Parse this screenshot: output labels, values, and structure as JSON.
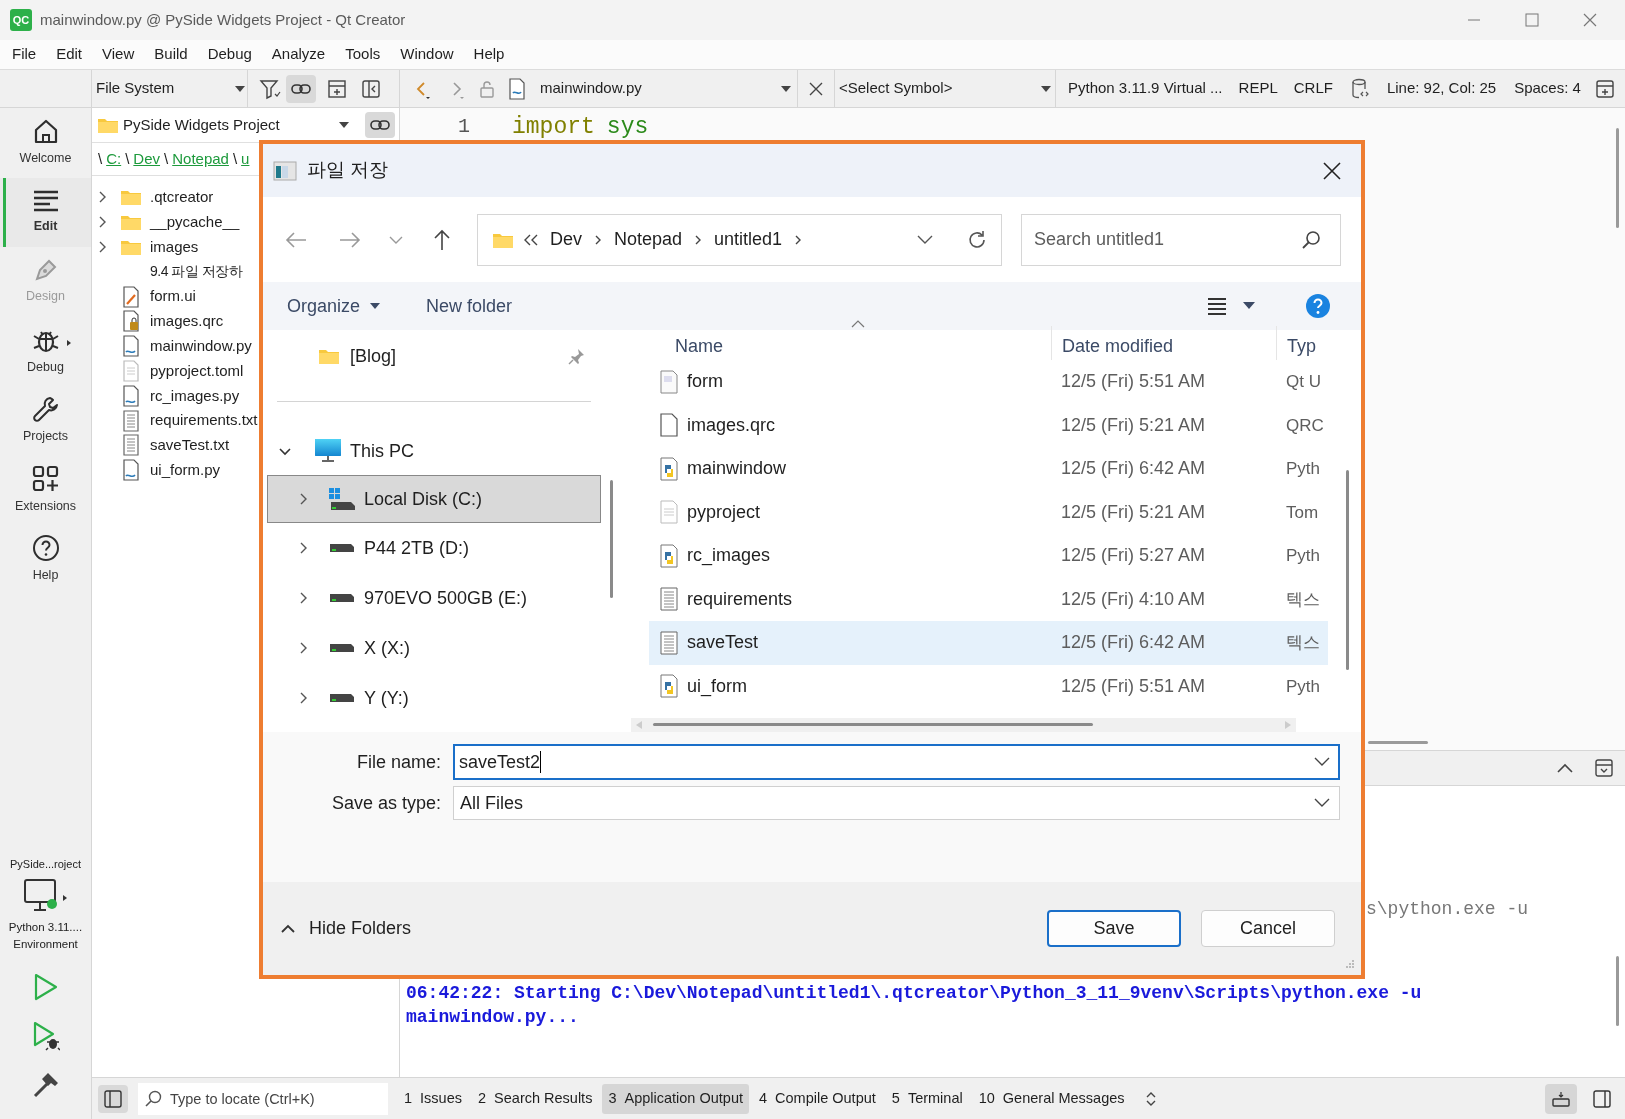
{
  "window": {
    "app_icon": "QC",
    "title": "mainwindow.py @ PySide Widgets Project - Qt Creator"
  },
  "menu": [
    "File",
    "Edit",
    "View",
    "Build",
    "Debug",
    "Analyze",
    "Tools",
    "Window",
    "Help"
  ],
  "toolbar": {
    "view_selector": "File System",
    "file_selector": "mainwindow.py",
    "symbol_selector": "<Select Symbol>",
    "interpreter": "Python 3.11.9 Virtual ...",
    "repl": "REPL",
    "line_endings": "CRLF",
    "position": "Line: 92, Col: 25",
    "indent": "Spaces: 4"
  },
  "modes": [
    {
      "label": "Welcome",
      "kind": "welcome",
      "selected": false,
      "disabled": false
    },
    {
      "label": "Edit",
      "kind": "edit",
      "selected": true,
      "disabled": false
    },
    {
      "label": "Design",
      "kind": "design",
      "selected": false,
      "disabled": true
    },
    {
      "label": "Debug",
      "kind": "debug",
      "selected": false,
      "disabled": false
    },
    {
      "label": "Projects",
      "kind": "projects",
      "selected": false,
      "disabled": false
    },
    {
      "label": "Extensions",
      "kind": "extensions",
      "selected": false,
      "disabled": false
    },
    {
      "label": "Help",
      "kind": "help",
      "selected": false,
      "disabled": false
    }
  ],
  "target": {
    "project": "PySide...roject",
    "kit": [
      "Python 3.11....",
      "Environment"
    ]
  },
  "project_tree": {
    "project": "PySide Widgets Project",
    "breadcrumb_separator": "\\",
    "breadcrumb": [
      "C:",
      "Dev",
      "Notepad",
      "u"
    ],
    "items": [
      {
        "name": ".qtcreator",
        "kind": "folder",
        "expanded": false
      },
      {
        "name": "__pycache__",
        "kind": "folder",
        "expanded": false
      },
      {
        "name": "images",
        "kind": "folder",
        "expanded": false
      },
      {
        "name": "9.4 파일 저장하",
        "kind": "plain"
      },
      {
        "name": "form.ui",
        "kind": "ui"
      },
      {
        "name": "images.qrc",
        "kind": "qrc"
      },
      {
        "name": "mainwindow.py",
        "kind": "py"
      },
      {
        "name": "pyproject.toml",
        "kind": "toml"
      },
      {
        "name": "rc_images.py",
        "kind": "py"
      },
      {
        "name": "requirements.txt",
        "kind": "txt"
      },
      {
        "name": "saveTest.txt",
        "kind": "txt"
      },
      {
        "name": "ui_form.py",
        "kind": "py"
      }
    ]
  },
  "editor": {
    "lines": [
      {
        "number": "1",
        "tokens": [
          {
            "text": "import",
            "kind": "keyword"
          },
          {
            "text": "sys",
            "kind": "module"
          }
        ]
      }
    ]
  },
  "output": [
    {
      "text": "s\\python.exe -u",
      "kind": "fragment"
    },
    {
      "text": "06:42:22: Starting C:\\Dev\\Notepad\\untitled1\\.qtcreator\\Python_3_11_9venv\\Scripts\\python.exe -u",
      "kind": "start"
    },
    {
      "text": "mainwindow.py...",
      "kind": "start"
    }
  ],
  "status_bar": {
    "locator_placeholder": "Type to locate (Ctrl+K)",
    "tabs": [
      {
        "number": "1",
        "label": "Issues",
        "selected": false
      },
      {
        "number": "2",
        "label": "Search Results",
        "selected": false
      },
      {
        "number": "3",
        "label": "Application Output",
        "selected": true
      },
      {
        "number": "4",
        "label": "Compile Output",
        "selected": false
      },
      {
        "number": "5",
        "label": "Terminal",
        "selected": false
      },
      {
        "number": "10",
        "label": "General Messages",
        "selected": false
      }
    ]
  },
  "dialog": {
    "title": "파일 저장",
    "address": [
      "Dev",
      "Notepad",
      "untitled1"
    ],
    "search_placeholder": "Search untitled1",
    "organize": "Organize",
    "new_folder": "New folder",
    "nav": [
      {
        "label": "[Blog]",
        "kind": "pinned",
        "selected": false
      },
      {
        "label": "This PC",
        "kind": "pc",
        "expanded": true,
        "selected": false
      },
      {
        "label": "Local Disk (C:)",
        "kind": "system_drive",
        "expanded": false,
        "selected": true
      },
      {
        "label": "P44 2TB (D:)",
        "kind": "drive",
        "expanded": false,
        "selected": false
      },
      {
        "label": "970EVO 500GB (E:)",
        "kind": "drive",
        "expanded": false,
        "selected": false
      },
      {
        "label": "X (X:)",
        "kind": "drive",
        "expanded": false,
        "selected": false
      },
      {
        "label": "Y (Y:)",
        "kind": "drive",
        "expanded": false,
        "selected": false
      }
    ],
    "columns": [
      "Name",
      "Date modified",
      "Typ"
    ],
    "files": [
      {
        "name": "form",
        "date": "12/5 (Fri) 5:51 AM",
        "type": "Qt U",
        "kind": "ui",
        "selected": false
      },
      {
        "name": "images.qrc",
        "date": "12/5 (Fri) 5:21 AM",
        "type": "QRC",
        "kind": "blank",
        "selected": false
      },
      {
        "name": "mainwindow",
        "date": "12/5 (Fri) 6:42 AM",
        "type": "Pyth",
        "kind": "python",
        "selected": false
      },
      {
        "name": "pyproject",
        "date": "12/5 (Fri) 5:21 AM",
        "type": "Tom",
        "kind": "config",
        "selected": false
      },
      {
        "name": "rc_images",
        "date": "12/5 (Fri) 5:27 AM",
        "type": "Pyth",
        "kind": "python",
        "selected": false
      },
      {
        "name": "requirements",
        "date": "12/5 (Fri) 4:10 AM",
        "type": "텍스",
        "kind": "text",
        "selected": false
      },
      {
        "name": "saveTest",
        "date": "12/5 (Fri) 6:42 AM",
        "type": "텍스",
        "kind": "text",
        "selected": true
      },
      {
        "name": "ui_form",
        "date": "12/5 (Fri) 5:51 AM",
        "type": "Pyth",
        "kind": "python",
        "selected": false
      }
    ],
    "file_name_label": "File name:",
    "file_name": "saveTest2",
    "type_label": "Save as type:",
    "save_as_type": "All Files",
    "hide_folders": "Hide Folders",
    "buttons": [
      {
        "label": "Save",
        "kind": "primary"
      },
      {
        "label": "Cancel",
        "kind": "secondary"
      }
    ]
  }
}
